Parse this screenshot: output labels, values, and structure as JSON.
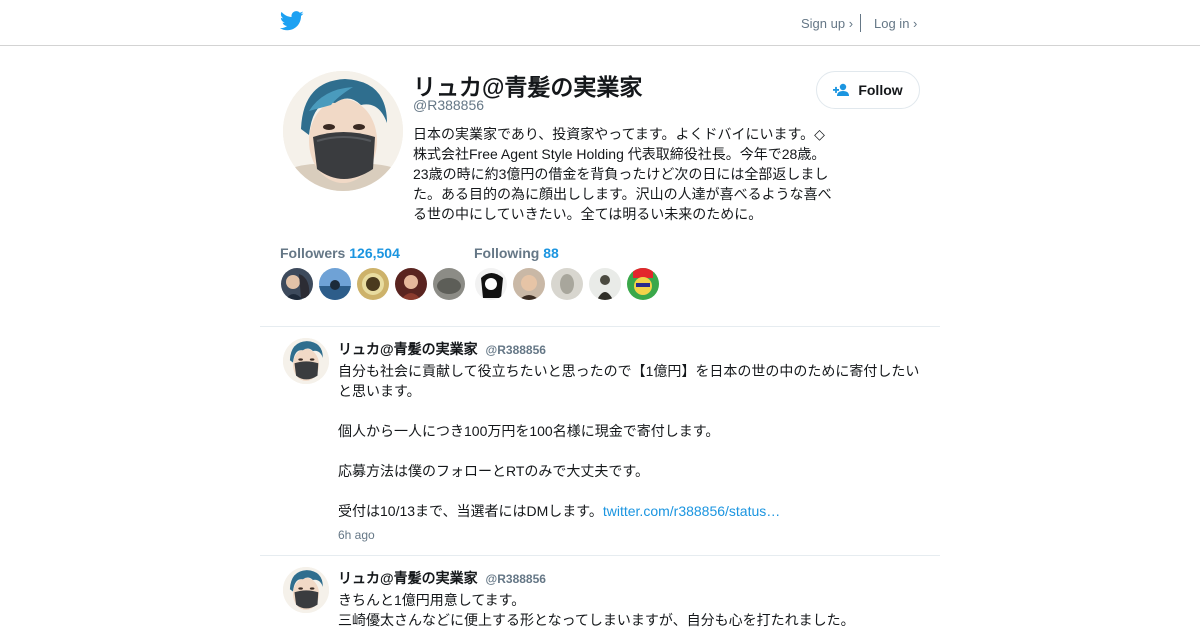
{
  "colors": {
    "accent": "#1b95e0",
    "logo": "#1da1f2",
    "muted": "#657786",
    "text": "#14171a",
    "border": "#e1e8ed"
  },
  "topbar": {
    "logo_icon": "twitter-bird-icon",
    "signup_label": "Sign up ›",
    "login_label": "Log in ›"
  },
  "profile": {
    "name": "リュカ@青髪の実業家",
    "handle": "@R388856",
    "bio": "日本の実業家であり、投資家やってます。よくドバイにいます。◇株式会社Free Agent Style Holding 代表取締役社長。今年で28歳。23歳の時に約3億円の借金を背負ったけど次の日には全部返しました。ある目的の為に顔出しします。沢山の人達が喜べるような喜べる世の中にしていきたい。全ては明るい未来のために。",
    "follow_label": "Follow",
    "follow_icon": "add-user-icon"
  },
  "stats": {
    "followers_label": "Followers",
    "followers_count": "126,504",
    "following_label": "Following",
    "following_count": "88"
  },
  "tweets": [
    {
      "name": "リュカ@青髪の実業家",
      "handle": "@R388856",
      "lines": [
        "自分も社会に貢献して役立ちたいと思ったので【1億円】を日本の世の中のために寄付したいと思います。",
        "個人から一人につき100万円を100名様に現金で寄付します。",
        "応募方法は僕のフォローとRTのみで大丈夫です。",
        "受付は10/13まで、当選者にはDMします。"
      ],
      "link": "twitter.com/r388856/status…",
      "time": "6h ago"
    },
    {
      "name": "リュカ@青髪の実業家",
      "handle": "@R388856",
      "lines": [
        "きちんと1億円用意してます。",
        "三崎優太さんなどに便上する形となってしまいますが、自分も心を打たれました。"
      ]
    }
  ]
}
